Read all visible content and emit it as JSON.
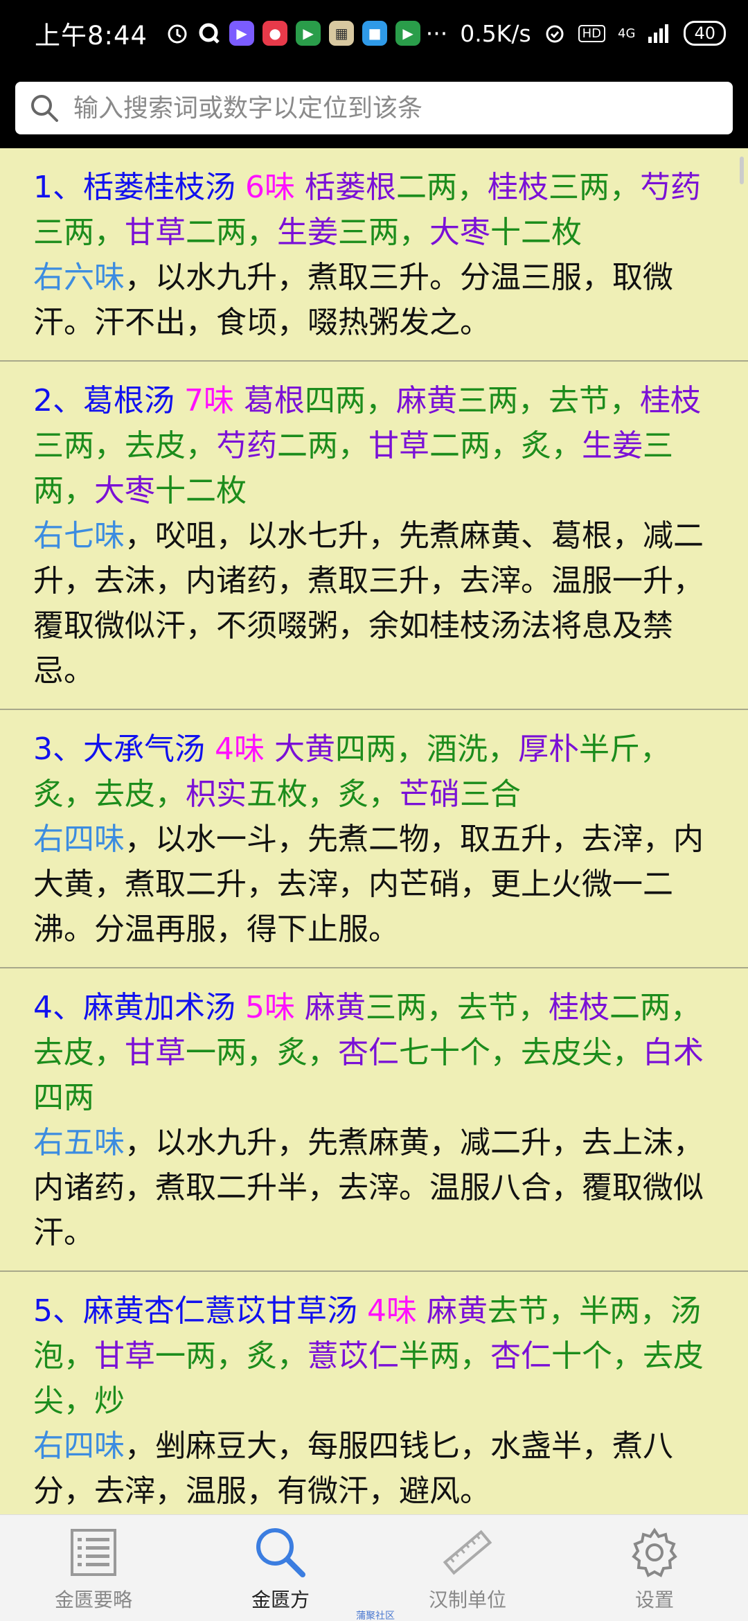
{
  "status_bar": {
    "time": "上午8:44",
    "net_speed": "0.5K/s",
    "signal_label": "4G",
    "battery": "40"
  },
  "search": {
    "placeholder": "输入搜索词或数字以定位到该条"
  },
  "recipes": [
    {
      "title": "1、栝蒌桂枝汤",
      "count": "6味",
      "ingredients": [
        {
          "herb": "栝蒌根",
          "dose": "二两，"
        },
        {
          "herb": "桂枝",
          "dose": "三两，"
        },
        {
          "herb": "芍药",
          "dose": "三两，"
        },
        {
          "herb": "甘草",
          "dose": "二两，"
        },
        {
          "herb": "生姜",
          "dose": "三两，"
        },
        {
          "herb": "大枣",
          "dose": "十二枚"
        }
      ],
      "method_count": "右六味",
      "method": "，以水九升，煮取三升。分温三服，取微汗。汗不出，食顷，啜热粥发之。"
    },
    {
      "title": "2、葛根汤",
      "count": "7味",
      "ingredients": [
        {
          "herb": "葛根",
          "dose": "四两，"
        },
        {
          "herb": "麻黄",
          "dose": "三两，去节，"
        },
        {
          "herb": "桂枝",
          "dose": "三两，去皮，"
        },
        {
          "herb": "芍药",
          "dose": "二两，"
        },
        {
          "herb": "甘草",
          "dose": "二两，炙，"
        },
        {
          "herb": "生姜",
          "dose": "三两，"
        },
        {
          "herb": "大枣",
          "dose": "十二枚"
        }
      ],
      "method_count": "右七味",
      "method": "，㕮咀，以水七升，先煮麻黄、葛根，减二升，去沫，内诸药，煮取三升，去滓。温服一升，覆取微似汗，不须啜粥，余如桂枝汤法将息及禁忌。"
    },
    {
      "title": "3、大承气汤",
      "count": "4味",
      "ingredients": [
        {
          "herb": "大黄",
          "dose": "四两，酒洗，"
        },
        {
          "herb": "厚朴",
          "dose": "半斤，炙，去皮，"
        },
        {
          "herb": "枳实",
          "dose": "五枚，炙，"
        },
        {
          "herb": "芒硝",
          "dose": "三合"
        }
      ],
      "method_count": "右四味",
      "method": "，以水一斗，先煮二物，取五升，去滓，内大黄，煮取二升，去滓，内芒硝，更上火微一二沸。分温再服，得下止服。"
    },
    {
      "title": "4、麻黄加术汤",
      "count": "5味",
      "ingredients": [
        {
          "herb": "麻黄",
          "dose": "三两，去节，"
        },
        {
          "herb": "桂枝",
          "dose": "二两，去皮，"
        },
        {
          "herb": "甘草",
          "dose": "一两，炙，"
        },
        {
          "herb": "杏仁",
          "dose": "七十个，去皮尖，"
        },
        {
          "herb": "白术",
          "dose": "四两"
        }
      ],
      "method_count": "右五味",
      "method": "，以水九升，先煮麻黄，减二升，去上沫，内诸药，煮取二升半，去滓。温服八合，覆取微似汗。"
    },
    {
      "title": "5、麻黄杏仁薏苡甘草汤",
      "count": "4味",
      "ingredients": [
        {
          "herb": "麻黄",
          "dose": "去节，半两，汤泡，"
        },
        {
          "herb": "甘草",
          "dose": "一两，炙，"
        },
        {
          "herb": "薏苡仁",
          "dose": "半两，"
        },
        {
          "herb": "杏仁",
          "dose": "十个，去皮尖，炒"
        }
      ],
      "method_count": "右四味",
      "method": "，剉麻豆大，每服四钱匕，水盏半，煮八分，去滓，温服，有微汗，避风。"
    }
  ],
  "nav": [
    {
      "label": "金匮要略",
      "icon": "list-icon",
      "active": false
    },
    {
      "label": "金匮方",
      "icon": "search-icon",
      "active": true
    },
    {
      "label": "汉制单位",
      "icon": "ruler-icon",
      "active": false
    },
    {
      "label": "设置",
      "icon": "gear-icon",
      "active": false
    }
  ],
  "watermark": "蒲聚社区",
  "colors": {
    "background": "#efefb6",
    "title": "#1111ee",
    "count": "#ff10ff",
    "herb": "#7a10d6",
    "dose": "#1c8c1c",
    "method_count": "#3c8ce0"
  }
}
